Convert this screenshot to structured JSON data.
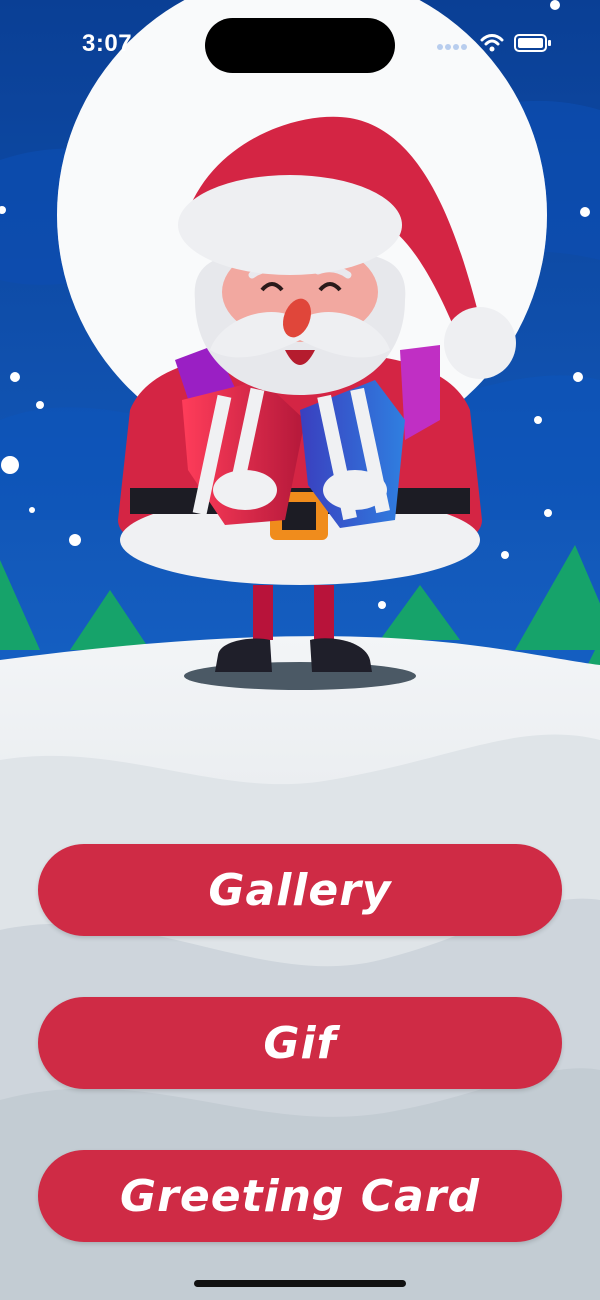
{
  "status_bar": {
    "time": "3:07",
    "icons": [
      "signal-dots-icon",
      "wifi-icon",
      "battery-icon"
    ]
  },
  "scene": {
    "illustration": "santa-with-gifts",
    "sky_color": "#0b4aa6",
    "moon_color": "#ffffff",
    "snow_color": "#e6eaee",
    "tree_color": "#16a36a"
  },
  "menu": {
    "gallery_label": "Gallery",
    "gif_label": "Gif",
    "greeting_card_label": "Greeting Card",
    "button_color": "#cf2b45",
    "text_color": "#ffffff"
  }
}
